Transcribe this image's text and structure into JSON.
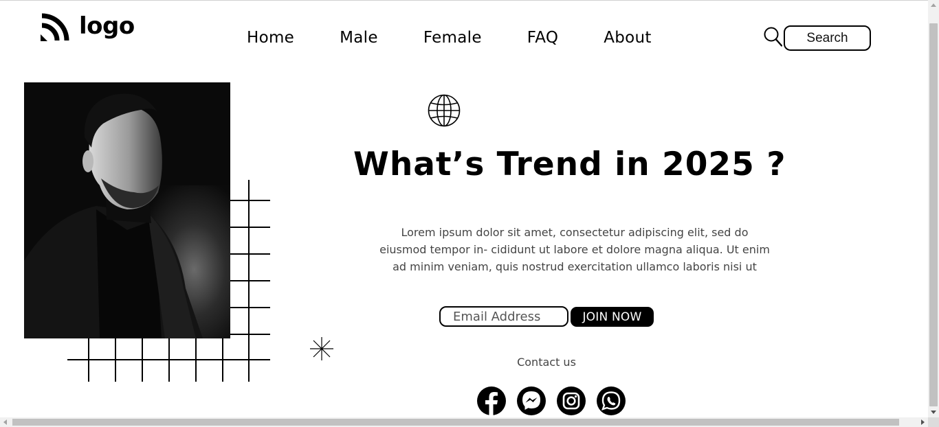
{
  "brand": {
    "logo_text": "logo",
    "logo_icon": "wifi-arcs-icon"
  },
  "nav": {
    "items": [
      {
        "label": "Home"
      },
      {
        "label": "Male"
      },
      {
        "label": "Female"
      },
      {
        "label": "FAQ"
      },
      {
        "label": "About"
      }
    ]
  },
  "search": {
    "icon": "search-icon",
    "label": "Search"
  },
  "hero": {
    "image": "portrait-photo",
    "globe_icon": "globe-icon",
    "title": "What’s Trend in 2025 ?",
    "body": "Lorem ipsum dolor sit amet, consectetur adipiscing elit, sed do eiusmod tempor in- cididunt ut labore et dolore magna aliqua. Ut enim ad minim veniam, quis nostrud exercitation ullamco laboris nisi ut"
  },
  "subscribe": {
    "email_placeholder": "Email Address",
    "email_value": "",
    "join_label": "JOIN NOW"
  },
  "contact": {
    "label": "Contact us",
    "socials": [
      {
        "icon": "facebook-icon"
      },
      {
        "icon": "messenger-icon"
      },
      {
        "icon": "instagram-icon"
      },
      {
        "icon": "whatsapp-icon"
      }
    ]
  },
  "colors": {
    "background": "#ffffff",
    "primary": "#000000",
    "body_text": "#444444",
    "join_text": "#ffffff"
  }
}
